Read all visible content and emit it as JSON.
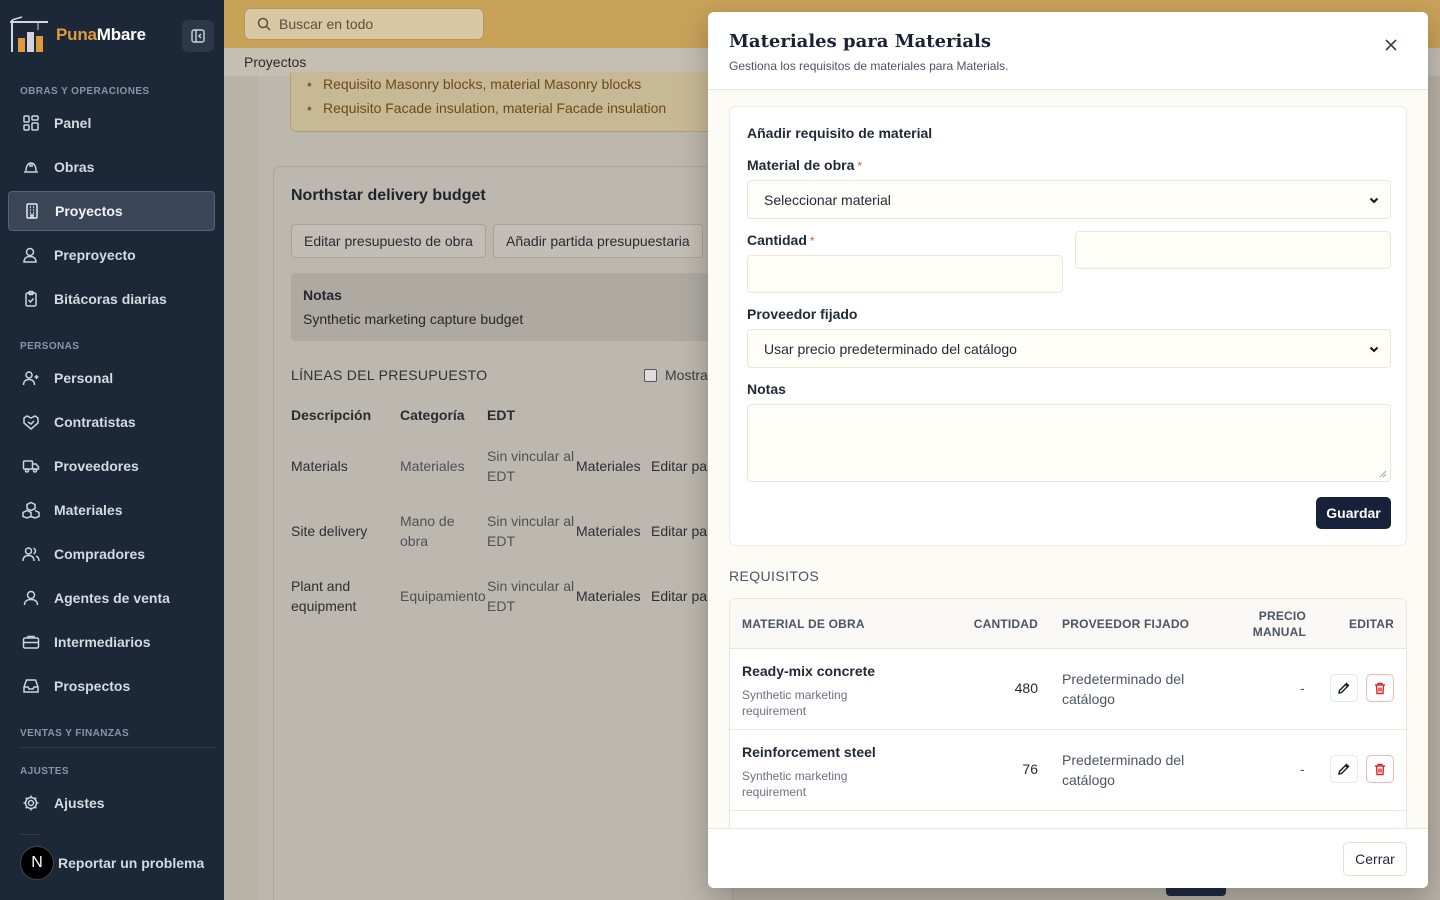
{
  "brand": {
    "name_part1": "Puna",
    "name_part2": "Mbare"
  },
  "search": {
    "placeholder": "Buscar en todo"
  },
  "breadcrumb": "Proyectos",
  "sidebar": {
    "sections": {
      "obras": "OBRAS Y OPERACIONES",
      "personas": "PERSONAS",
      "ventas": "VENTAS Y FINANZAS",
      "ajustes": "AJUSTES"
    },
    "items": {
      "panel": "Panel",
      "obras": "Obras",
      "proyectos": "Proyectos",
      "preproyecto": "Preproyecto",
      "bitacoras": "Bitácoras diarias",
      "personal": "Personal",
      "contratistas": "Contratistas",
      "proveedores": "Proveedores",
      "materiales": "Materiales",
      "compradores": "Compradores",
      "agentes": "Agentes de venta",
      "intermediarios": "Intermediarios",
      "prospectos": "Prospectos",
      "ajustes": "Ajustes"
    },
    "report": "Reportar un problema",
    "badge": "N"
  },
  "background": {
    "alerts": [
      "Requisito Masonry blocks, material Masonry blocks",
      "Requisito Facade insulation, material Facade insulation"
    ],
    "budget_title": "Northstar delivery budget",
    "edit_budget": "Editar presupuesto de obra",
    "add_line": "Añadir partida presupuestaria",
    "notes_label": "Notas",
    "notes_value": "Synthetic marketing capture budget",
    "lines_title": "LÍNEAS DEL PRESUPUESTO",
    "show_label": "Mostra",
    "headers": {
      "desc": "Descripción",
      "cat": "Categoría",
      "edt": "EDT"
    },
    "rows": [
      {
        "desc": "Materials",
        "cat": "Materiales",
        "edt": "Sin vincular al EDT",
        "mat": "Materiales",
        "edit": "Editar par"
      },
      {
        "desc": "Site delivery",
        "cat": "Mano de obra",
        "edt": "Sin vincular al EDT",
        "mat": "Materiales",
        "edit": "Editar par"
      },
      {
        "desc": "Plant and equipment",
        "cat": "Equipamiento",
        "edt": "Sin vincular al EDT",
        "mat": "Materiales",
        "edit": "Editar par"
      }
    ]
  },
  "modal": {
    "title": "Materiales para Materials",
    "subtitle": "Gestiona los requisitos de materiales para Materials.",
    "form": {
      "heading": "Añadir requisito de material",
      "material_label": "Material de obra",
      "material_value": "Seleccionar material",
      "qty_label": "Cantidad",
      "qty_value": "",
      "unit_value": "",
      "supplier_label": "Proveedor fijado",
      "supplier_value": "Usar precio predeterminado del catálogo",
      "notes_label": "Notas",
      "notes_value": "",
      "required_mark": "*",
      "save": "Guardar"
    },
    "requirements_title": "REQUISITOS",
    "table_headers": {
      "material": "MATERIAL DE OBRA",
      "qty": "CANTIDAD",
      "supplier": "PROVEEDOR FIJADO",
      "manual_1": "PRECIO",
      "manual_2": "MANUAL",
      "edit": "EDITAR"
    },
    "rows": [
      {
        "name": "Ready-mix concrete",
        "desc": "Synthetic marketing requirement",
        "qty": "480",
        "supplier": "Predeterminado del catálogo",
        "manual": "-"
      },
      {
        "name": "Reinforcement steel",
        "desc": "Synthetic marketing requirement",
        "qty": "76",
        "supplier": "Predeterminado del catálogo",
        "manual": "-"
      }
    ],
    "close": "Cerrar"
  },
  "colors": {
    "sidebar": "#1c2738",
    "primary": "#17223a",
    "accent": "#e09a3c",
    "danger": "#dc2626"
  }
}
